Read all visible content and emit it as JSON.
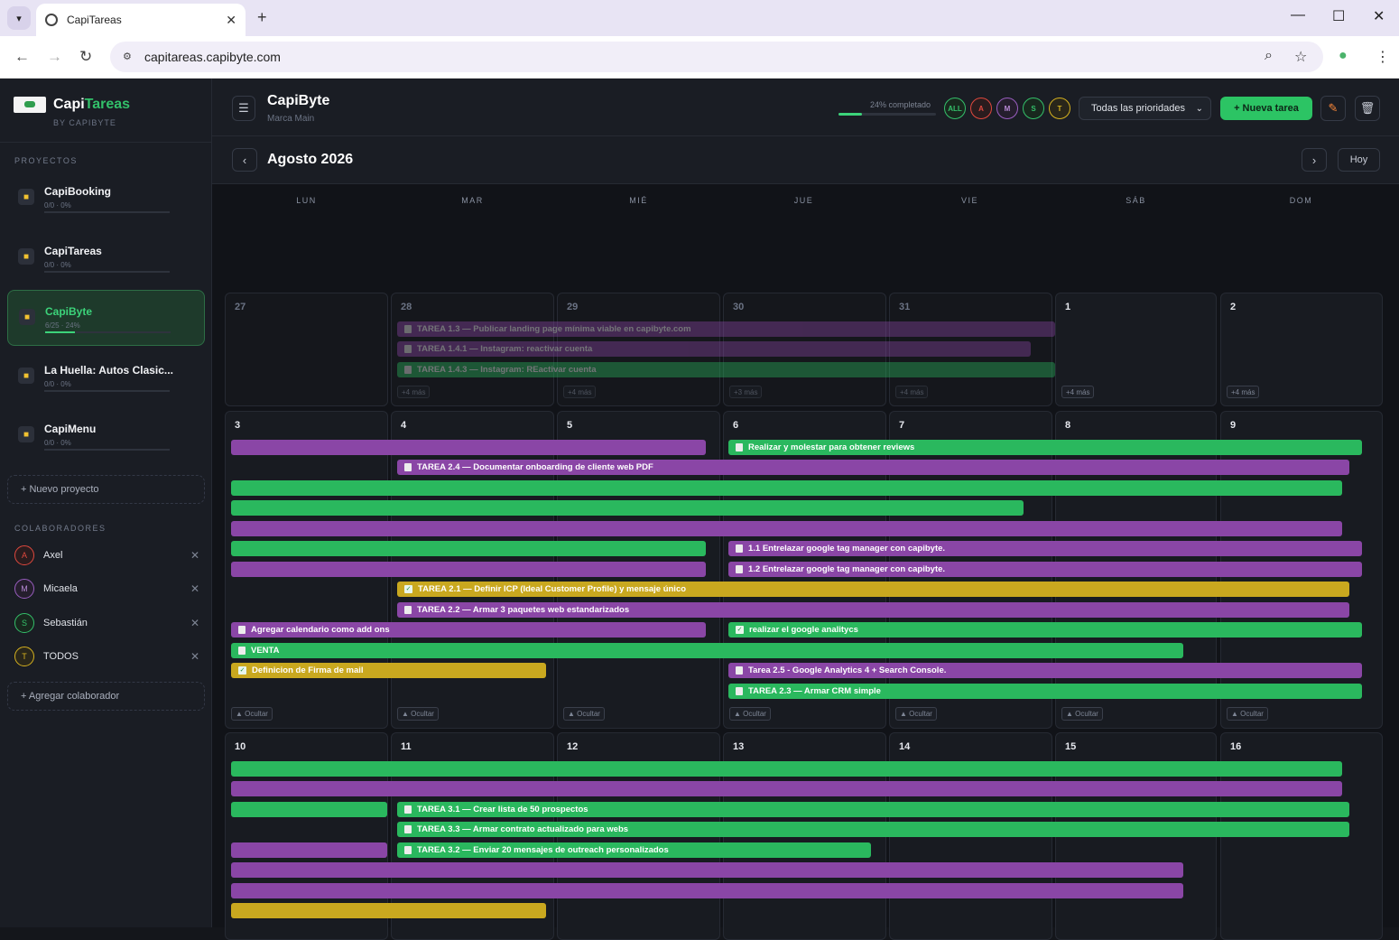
{
  "browser": {
    "tab_title": "CapiTareas",
    "url": "capitareas.capibyte.com"
  },
  "sidebar": {
    "brand_a": "Capi",
    "brand_b": "Tareas",
    "brand_sub": "BY CAPIBYTE",
    "projects_label": "PROYECTOS",
    "projects": [
      {
        "name": "CapiBooking",
        "meta": "0/0 · 0%",
        "progress": 0
      },
      {
        "name": "CapiTareas",
        "meta": "0/0 · 0%",
        "progress": 0
      },
      {
        "name": "CapiByte",
        "meta": "6/25 · 24%",
        "progress": 24
      },
      {
        "name": "La Huella: Autos Clasic...",
        "meta": "0/0 · 0%",
        "progress": 0
      },
      {
        "name": "CapiMenu",
        "meta": "0/0 · 0%",
        "progress": 0
      }
    ],
    "new_project": "+  Nuevo proyecto",
    "collab_label": "COLABORADORES",
    "collaborators": [
      {
        "initial": "A",
        "name": "Axel",
        "color": "#e0483e"
      },
      {
        "initial": "M",
        "name": "Micaela",
        "color": "#9a5ec0"
      },
      {
        "initial": "S",
        "name": "Sebastián",
        "color": "#34c06a"
      },
      {
        "initial": "T",
        "name": "TODOS",
        "color": "#d6b21f"
      }
    ],
    "add_collab": "+  Agregar colaborador"
  },
  "header": {
    "title": "CapiByte",
    "subtitle": "Marca Main",
    "progress_label": "24% completado",
    "progress": 24,
    "filters": [
      {
        "label": "ALL",
        "color": "#34c06a"
      },
      {
        "label": "A",
        "color": "#e0483e"
      },
      {
        "label": "M",
        "color": "#9a5ec0"
      },
      {
        "label": "S",
        "color": "#34c06a"
      },
      {
        "label": "T",
        "color": "#d6b21f"
      }
    ],
    "priority": "Todas las prioridades",
    "new_task": "+  Nueva tarea"
  },
  "calendar": {
    "month": "Agosto 2026",
    "today": "Hoy",
    "weekdays": [
      "LUN",
      "MAR",
      "MIÉ",
      "JUE",
      "VIE",
      "SÁB",
      "DOM"
    ],
    "weeks": [
      [
        "27",
        "28",
        "29",
        "30",
        "31",
        "1",
        "2"
      ],
      [
        "3",
        "4",
        "5",
        "6",
        "7",
        "8",
        "9"
      ],
      [
        "10",
        "11",
        "12",
        "13",
        "14",
        "15",
        "16"
      ]
    ],
    "more": [
      "+4 más",
      "+4 más",
      "+3 más",
      "+4 más",
      "+4 más",
      "+4 más"
    ],
    "hide": "▲ Ocultar",
    "tasks": {
      "w1_1": "TAREA 1.3 — Publicar landing page mínima viable en capibyte.com",
      "w1_2": "TAREA 1.4.1 — Instagram: reactivar cuenta",
      "w1_3": "TAREA 1.4.3 — Instagram: REactivar cuenta",
      "w2_1": "Realizar y molestar para obtener reviews",
      "w2_2": "TAREA 2.4 — Documentar onboarding de cliente web PDF",
      "w2_3": "1.1 Entrelazar google tag manager con capibyte.",
      "w2_4": "1.2 Entrelazar google tag manager con capibyte.",
      "w2_5": "TAREA 2.1 — Definir ICP (Ideal Customer Profile) y mensaje único",
      "w2_6": "TAREA 2.2 — Armar 3 paquetes web estandarizados",
      "w2_7": "Agregar calendario como add ons",
      "w2_8": "realizar el google analitycs",
      "w2_9": "VENTA",
      "w2_10": "Definicion de Firma de mail",
      "w2_11": "Tarea 2.5 - Google Analytics 4 + Search Console.",
      "w2_12": "TAREA 2.3 — Armar CRM simple",
      "w3_1": "TAREA 3.1 — Crear lista de 50 prospectos",
      "w3_2": "TAREA 3.3 — Armar contrato actualizado para webs",
      "w3_3": "TAREA 3.2 — Enviar 20 mensajes de outreach personalizados"
    }
  },
  "colors": {
    "green": "#2ab85e",
    "purple": "#8a46a6",
    "yellow": "#c9a81f",
    "accent": "#3cd37a"
  }
}
